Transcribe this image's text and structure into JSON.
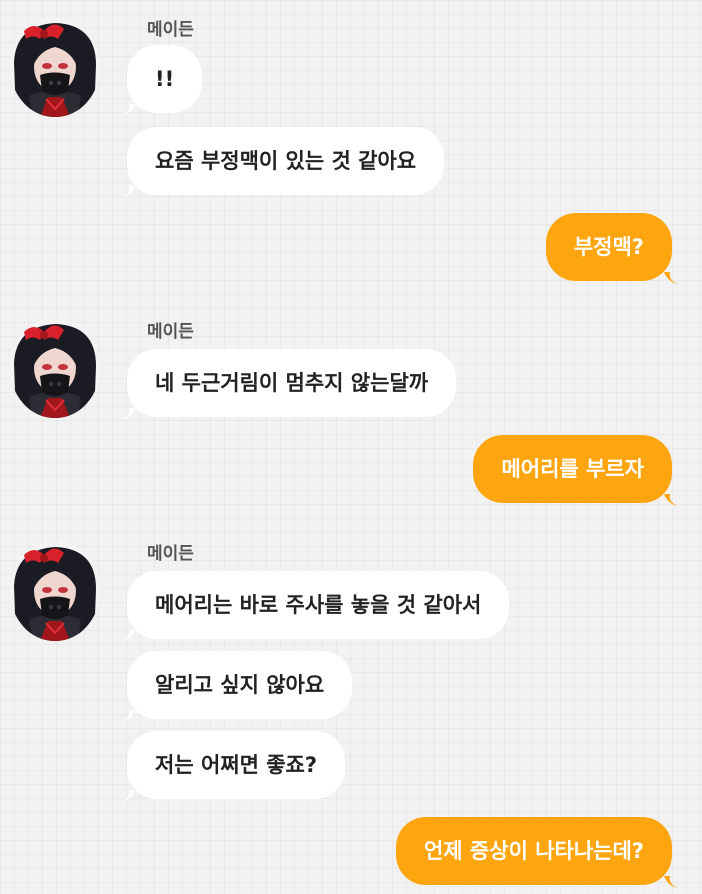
{
  "colors": {
    "background": "#f2f2f2",
    "incoming_bubble": "#ffffff",
    "outgoing_bubble": "#ffa50f",
    "incoming_text": "#222222",
    "outgoing_text": "#ffffff",
    "sender_name": "#555555"
  },
  "contact": {
    "name": "메이든",
    "avatar_icon": "character-portrait-icon"
  },
  "messages": [
    {
      "from": "contact",
      "text": "!!"
    },
    {
      "from": "contact",
      "text": "요즘 부정맥이 있는 것 같아요"
    },
    {
      "from": "me",
      "text": "부정맥?"
    },
    {
      "from": "contact",
      "text": "네 두근거림이 멈추지 않는달까"
    },
    {
      "from": "me",
      "text": "메어리를 부르자"
    },
    {
      "from": "contact",
      "text": "메어리는 바로 주사를 놓을 것 같아서"
    },
    {
      "from": "contact",
      "text": "알리고 싶지 않아요"
    },
    {
      "from": "contact",
      "text": "저는 어쩌면 좋죠?"
    },
    {
      "from": "me",
      "text": "언제 증상이 나타나는데?"
    }
  ]
}
